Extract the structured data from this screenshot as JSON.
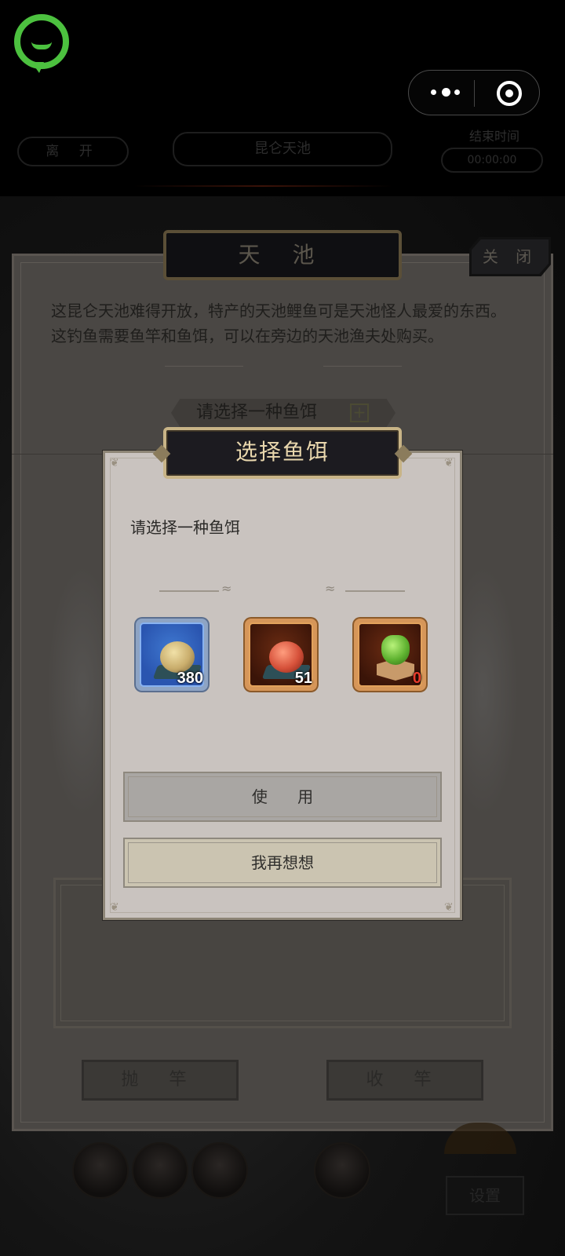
{
  "topbar": {
    "more_icon": "more-dots-icon",
    "target_icon": "record-target-icon",
    "logo_icon": "chat-bubble-logo-icon"
  },
  "header": {
    "leave_label": "离 开",
    "location": "昆仑天池",
    "end_time_label": "结束时间",
    "end_time_value": "00:00:00"
  },
  "panel": {
    "title": "天 池",
    "close_label": "关 闭",
    "description": "这昆仑天池难得开放，特产的天池鲤鱼可是天池怪人最爱的东西。这钓鱼需要鱼竿和鱼饵，可以在旁边的天池渔夫处购买。",
    "bait_select_label": "请选择一种鱼饵",
    "bait_select_plus": "+",
    "cast_label": "抛 竿",
    "reel_label": "收 竿",
    "settings_label": "设置"
  },
  "dialog": {
    "title": "选择鱼饵",
    "prompt": "请选择一种鱼饵",
    "baits": [
      {
        "name": "bait-plain",
        "count": "380",
        "rarity": "blue"
      },
      {
        "name": "bait-red",
        "count": "51",
        "rarity": "orange"
      },
      {
        "name": "bait-green",
        "count": "0",
        "rarity": "orange"
      }
    ],
    "use_label": "使 用",
    "cancel_label": "我再想想"
  },
  "colors": {
    "accent_gold": "#c8b487",
    "dialog_bg": "#c9c3bf",
    "logo_green": "#4cc13f"
  }
}
